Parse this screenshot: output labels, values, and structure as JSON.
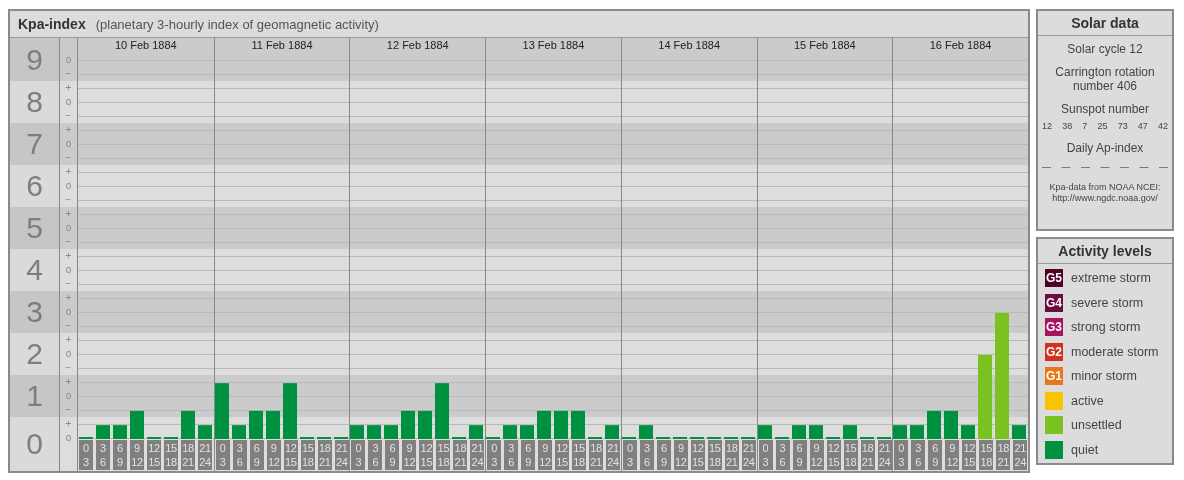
{
  "header": {
    "title": "Kpa-index",
    "subtitle": "(planetary 3-hourly index of geomagnetic activity)"
  },
  "days": [
    "10 Feb 1884",
    "11 Feb 1884",
    "12 Feb 1884",
    "13 Feb 1884",
    "14 Feb 1884",
    "15 Feb 1884",
    "16 Feb 1884"
  ],
  "y_marks": [
    [
      "o",
      "−"
    ],
    [
      "+",
      "o",
      "−"
    ],
    [
      "+",
      "o",
      "−"
    ],
    [
      "+",
      "o",
      "−"
    ],
    [
      "+",
      "o",
      "−"
    ],
    [
      "+",
      "o",
      "−"
    ],
    [
      "+",
      "o",
      "−"
    ],
    [
      "+",
      "o",
      "−"
    ],
    [
      "+",
      "o",
      "−"
    ],
    [
      "+",
      "o"
    ]
  ],
  "chart_data": {
    "type": "bar",
    "ylim": [
      0,
      9
    ],
    "yticks": [
      {
        "value": 0,
        "label": "0"
      },
      {
        "value": 1,
        "label": "1"
      },
      {
        "value": 2,
        "label": "2"
      },
      {
        "value": 3,
        "label": "3"
      },
      {
        "value": 4,
        "label": "4"
      },
      {
        "value": 5,
        "label": "5"
      },
      {
        "value": 6,
        "label": "6"
      },
      {
        "value": 7,
        "label": "7"
      },
      {
        "value": 8,
        "label": "8"
      },
      {
        "value": 9,
        "label": "9"
      }
    ],
    "grid": true,
    "categories": [
      "0 3",
      "3 6",
      "6 9",
      "9 12",
      "12 15",
      "15 18",
      "18 21",
      "21 24",
      "0 3",
      "3 6",
      "6 9",
      "9 12",
      "12 15",
      "15 18",
      "18 21",
      "21 24",
      "0 3",
      "3 6",
      "6 9",
      "9 12",
      "12 15",
      "15 18",
      "18 21",
      "21 24",
      "0 3",
      "3 6",
      "6 9",
      "9 12",
      "12 15",
      "15 18",
      "18 21",
      "21 24",
      "0 3",
      "3 6",
      "6 9",
      "9 12",
      "12 15",
      "15 18",
      "18 21",
      "21 24",
      "0 3",
      "3 6",
      "6 9",
      "9 12",
      "12 15",
      "15 18",
      "18 21",
      "21 24",
      "0 3",
      "3 6",
      "6 9",
      "9 12",
      "12 15",
      "15 18",
      "18 21",
      "21 24"
    ],
    "series": [
      {
        "color": "#009140",
        "values": [
          0,
          0.33,
          0.33,
          0.67,
          0,
          0,
          0.67,
          0.33,
          1.33,
          0.33,
          0.67,
          0.67,
          1.33,
          0,
          0,
          0,
          0.33,
          0.33,
          0.33,
          0.67,
          0.67,
          1.33,
          0,
          0.33,
          0,
          0.33,
          0.33,
          0.67,
          0.67,
          0.67,
          0,
          0.33,
          0,
          0.33,
          0,
          0,
          0,
          0,
          0,
          0,
          0.33,
          0,
          0.33,
          0.33,
          0,
          0.33,
          0,
          0,
          0.33,
          0.33,
          0.67,
          0.67,
          0.33,
          null,
          null,
          0.33
        ]
      },
      {
        "color": "#7ac221",
        "values": [
          null,
          null,
          null,
          null,
          null,
          null,
          null,
          null,
          null,
          null,
          null,
          null,
          null,
          null,
          null,
          null,
          null,
          null,
          null,
          null,
          null,
          null,
          null,
          null,
          null,
          null,
          null,
          null,
          null,
          null,
          null,
          null,
          null,
          null,
          null,
          null,
          null,
          null,
          null,
          null,
          null,
          null,
          null,
          null,
          null,
          null,
          null,
          null,
          null,
          null,
          null,
          null,
          null,
          2,
          3,
          null
        ]
      }
    ]
  },
  "solar_data": {
    "title": "Solar data",
    "cycle": "Solar cycle 12",
    "carrington": "Carrington rotation number 406",
    "sunspot_title": "Sunspot number",
    "sunspots": [
      "12",
      "38",
      "7",
      "25",
      "73",
      "47",
      "42"
    ],
    "ap_title": "Daily Ap-index",
    "ap_values": [
      "—",
      "—",
      "—",
      "—",
      "—",
      "—",
      "—"
    ],
    "source_note": "Kpa-data from NOAA NCEI:",
    "source_url": "http://www.ngdc.noaa.gov/"
  },
  "activity_levels": {
    "title": "Activity levels",
    "items": [
      {
        "badge": "G5",
        "label": "extreme storm",
        "color": "#4f0027"
      },
      {
        "badge": "G4",
        "label": "severe storm",
        "color": "#6c0b40"
      },
      {
        "badge": "G3",
        "label": "strong storm",
        "color": "#a8135f"
      },
      {
        "badge": "G2",
        "label": "moderate storm",
        "color": "#d3301f"
      },
      {
        "badge": "G1",
        "label": "minor storm",
        "color": "#e8771b"
      },
      {
        "label": "active",
        "color": "#f8c400"
      },
      {
        "label": "unsettled",
        "color": "#7ac221"
      },
      {
        "label": "quiet",
        "color": "#009140"
      }
    ]
  }
}
